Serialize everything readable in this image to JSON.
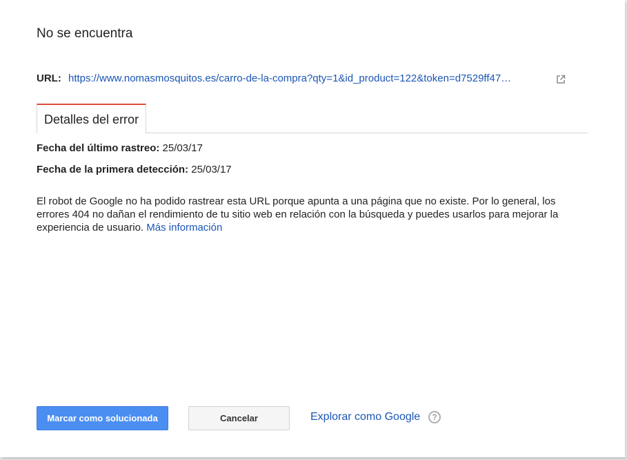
{
  "dialog": {
    "title": "No se encuentra",
    "url_label": "URL:",
    "url_value": "https://www.nomasmosquitos.es/carro-de-la-compra?qty=1&id_product=122&token=d7529ff47…",
    "external_link_icon": "external-link-icon",
    "tab_label": "Detalles del error",
    "last_crawl_label": "Fecha del último rastreo:",
    "last_crawl_value": "25/03/17",
    "first_detected_label": "Fecha de la primera detección:",
    "first_detected_value": "25/03/17",
    "description": "El robot de Google no ha podido rastrear esta URL porque apunta a una página que no existe. Por lo general, los errores 404 no dañan el rendimiento de tu sitio web en relación con la búsqueda y puedes usarlos para mejorar la experiencia de usuario.",
    "more_info_link": "Más información",
    "mark_fixed_button": "Marcar como solucionada",
    "cancel_button": "Cancelar",
    "fetch_as_google_link": "Explorar como Google",
    "help_icon": "?"
  },
  "colors": {
    "primary_button": "#4b8ef1",
    "link": "#1a55b5",
    "tab_accent": "#dd4b39"
  }
}
